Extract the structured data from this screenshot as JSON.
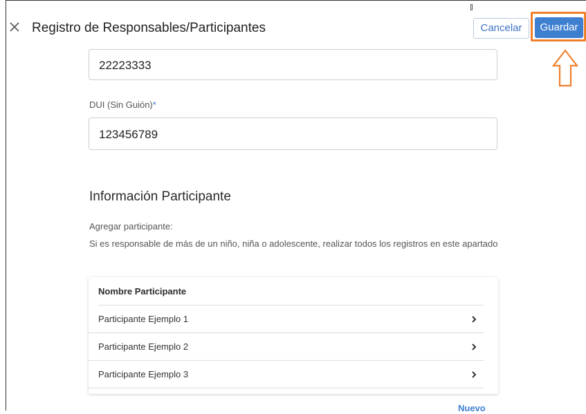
{
  "header": {
    "title": "Registro de Responsables/Participantes",
    "close_icon": "close-icon",
    "cancel_label": "Cancelar",
    "save_label": "Guardar"
  },
  "form": {
    "phone_value": "22223333",
    "dui_label": "DUI (Sin Guión)",
    "dui_required": "*",
    "dui_value": "123456789"
  },
  "participants": {
    "section_title": "Información Participante",
    "help_line_1": "Agregar participante:",
    "help_line_2": "Si es responsable de más de un niño, niña o adolescente, realizar todos los registros en este apartado",
    "table_header": "Nombre Participante",
    "rows": [
      {
        "label": "Participante Ejemplo 1"
      },
      {
        "label": "Participante Ejemplo 2"
      },
      {
        "label": "Participante Ejemplo 3"
      }
    ],
    "new_label": "Nuevo"
  },
  "annotation": {
    "highlight_color": "#f07f2c",
    "arrow_icon": "up-arrow-icon"
  },
  "colors": {
    "accent": "#3f7fd0"
  }
}
